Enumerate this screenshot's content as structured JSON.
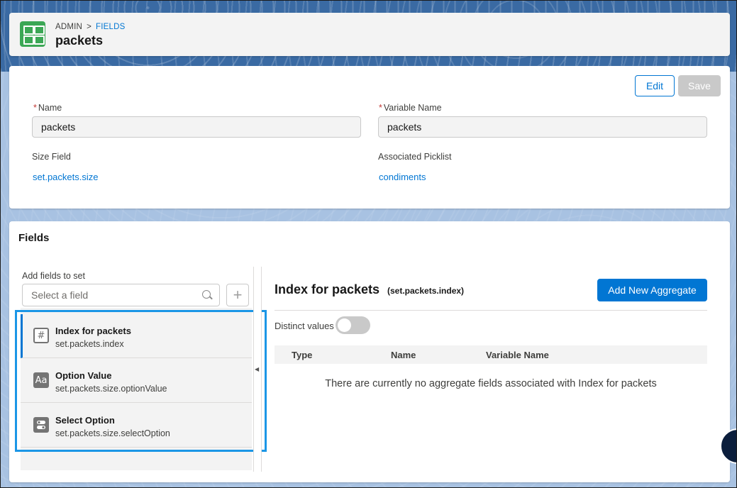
{
  "header": {
    "breadcrumb_root": "ADMIN",
    "breadcrumb_sep": ">",
    "breadcrumb_current": "FIELDS",
    "title": "packets",
    "icon": "grid-table-icon"
  },
  "record": {
    "edit_label": "Edit",
    "save_label": "Save",
    "name_label": "Name",
    "name_value": "packets",
    "variable_name_label": "Variable Name",
    "variable_name_value": "packets",
    "size_field_label": "Size Field",
    "size_field_value": "set.packets.size",
    "picklist_label": "Associated Picklist",
    "picklist_value": "condiments",
    "required_mark": "*"
  },
  "fields": {
    "title": "Fields",
    "add_label": "Add fields to set",
    "search_placeholder": "Select a field",
    "add_icon": "+",
    "items": [
      {
        "name": "Index for packets",
        "var": "set.packets.index",
        "icon": "#",
        "selected": true
      },
      {
        "name": "Option Value",
        "var": "set.packets.size.optionValue",
        "icon": "Aa",
        "selected": false
      },
      {
        "name": "Select Option",
        "var": "set.packets.size.selectOption",
        "icon": "toggle-icon",
        "selected": false
      }
    ]
  },
  "detail": {
    "title": "Index for packets",
    "subtitle": "(set.packets.index)",
    "add_button": "Add New Aggregate",
    "distinct_label": "Distinct values",
    "distinct_on": false,
    "columns": [
      "Type",
      "Name",
      "Variable Name"
    ],
    "empty_message": "There are currently no aggregate fields associated with Index for packets"
  },
  "colors": {
    "brand": "#0176d3",
    "app_icon": "#3ba755",
    "highlight": "#1b96e6"
  }
}
